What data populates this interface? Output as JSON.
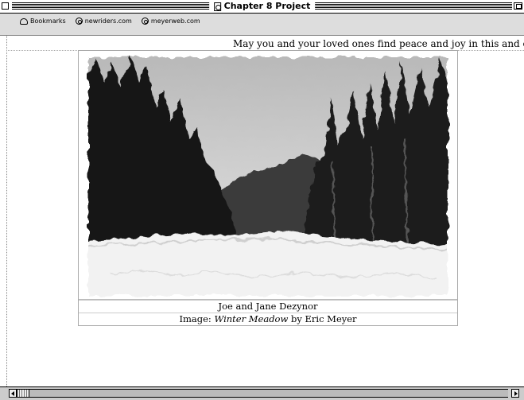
{
  "window": {
    "title": "Chapter 8 Project"
  },
  "bookmarks": [
    {
      "label": "Bookmarks",
      "icon": "bookmarks-icon"
    },
    {
      "label": "newriders.com",
      "icon": "globe-icon"
    },
    {
      "label": "meyerweb.com",
      "icon": "globe-icon"
    }
  ],
  "page": {
    "greeting": "May you and your loved ones find peace and joy in this and every season.",
    "photo_alt": "Winter Meadow photograph",
    "caption_names": "Joe and Jane Dezynor",
    "credit_prefix": "Image: ",
    "credit_title": "Winter Meadow",
    "credit_suffix": " by Eric Meyer"
  }
}
